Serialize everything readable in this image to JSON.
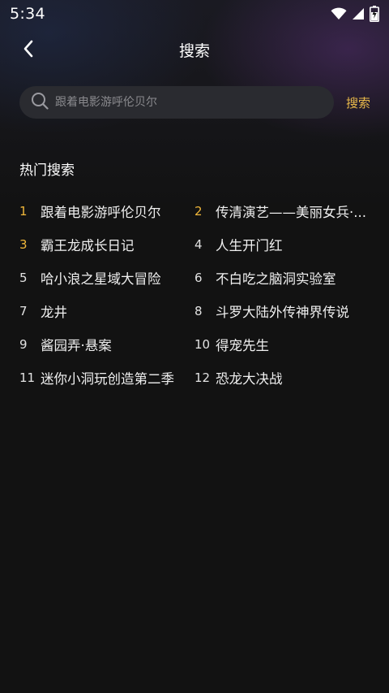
{
  "status_bar": {
    "time": "5:34"
  },
  "header": {
    "title": "搜索"
  },
  "search": {
    "placeholder": "跟着电影游呼伦贝尔",
    "button_label": "搜索"
  },
  "hot_search": {
    "title": "热门搜索",
    "items": [
      {
        "rank": "1",
        "label": "跟着电影游呼伦贝尔"
      },
      {
        "rank": "2",
        "label": "传清演艺——美丽女兵·..."
      },
      {
        "rank": "3",
        "label": "霸王龙成长日记"
      },
      {
        "rank": "4",
        "label": "人生开门红"
      },
      {
        "rank": "5",
        "label": "哈小浪之星域大冒险"
      },
      {
        "rank": "6",
        "label": "不白吃之脑洞实验室"
      },
      {
        "rank": "7",
        "label": "龙井"
      },
      {
        "rank": "8",
        "label": "斗罗大陆外传神界传说"
      },
      {
        "rank": "9",
        "label": "酱园弄·悬案"
      },
      {
        "rank": "10",
        "label": "得宠先生"
      },
      {
        "rank": "11",
        "label": "迷你小洞玩创造第二季"
      },
      {
        "rank": "12",
        "label": "恐龙大决战"
      }
    ]
  },
  "colors": {
    "accent": "#e9b94a",
    "top_rank": "#f0b73a",
    "background": "#121212",
    "search_box": "#2a2b30"
  },
  "icons": {
    "back": "chevron-left-icon",
    "search": "search-icon",
    "wifi": "wifi-icon",
    "signal": "signal-icon",
    "battery": "battery-charging-icon"
  }
}
